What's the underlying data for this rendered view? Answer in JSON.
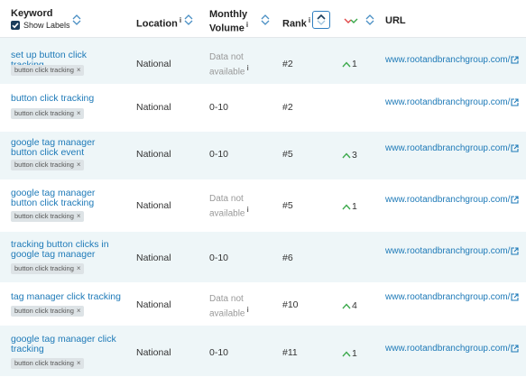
{
  "header": {
    "keyword": "Keyword",
    "show_labels": "Show Labels",
    "location": "Location",
    "monthly_line1": "Monthly",
    "monthly_line2": "Volume",
    "rank": "Rank",
    "url": "URL",
    "info_mark": "i"
  },
  "rows": [
    {
      "keyword": "set up button click tracking",
      "tag": "button click tracking",
      "location": "National",
      "volume": "",
      "volume_na_1": "Data not",
      "volume_na_2": "available",
      "rank": "#2",
      "change": "1",
      "url": "www.rootandbranchgroup.com/"
    },
    {
      "keyword": "button click tracking",
      "tag": "button click tracking",
      "location": "National",
      "volume": "0-10",
      "rank": "#2",
      "change": "",
      "url": "www.rootandbranchgroup.com/"
    },
    {
      "keyword": "google tag manager button click event",
      "tag": "button click tracking",
      "location": "National",
      "volume": "0-10",
      "rank": "#5",
      "change": "3",
      "url": "www.rootandbranchgroup.com/"
    },
    {
      "keyword": "google tag manager button click tracking",
      "tag": "button click tracking",
      "location": "National",
      "volume": "",
      "volume_na_1": "Data not",
      "volume_na_2": "available",
      "rank": "#5",
      "change": "1",
      "url": "www.rootandbranchgroup.com/"
    },
    {
      "keyword": "tracking button clicks in google tag manager",
      "tag": "button click tracking",
      "location": "National",
      "volume": "0-10",
      "rank": "#6",
      "change": "",
      "url": "www.rootandbranchgroup.com/"
    },
    {
      "keyword": "tag manager click tracking",
      "tag": "button click tracking",
      "location": "National",
      "volume": "",
      "volume_na_1": "Data not",
      "volume_na_2": "available",
      "rank": "#10",
      "change": "4",
      "url": "www.rootandbranchgroup.com/"
    },
    {
      "keyword": "google tag manager click tracking",
      "tag": "button click tracking",
      "location": "National",
      "volume": "0-10",
      "rank": "#11",
      "change": "1",
      "url": "www.rootandbranchgroup.com/"
    }
  ],
  "tag_close": "×",
  "colors": {
    "link": "#1e7ab8",
    "up": "#3aa84a",
    "down": "#e04848",
    "alt_row": "#eef6f8",
    "active_sort": "#2f7fc1"
  },
  "icons": [
    "sort-icon",
    "checkbox-checked-icon",
    "info-icon",
    "trend-icon",
    "up-arrow-icon",
    "external-link-icon"
  ]
}
